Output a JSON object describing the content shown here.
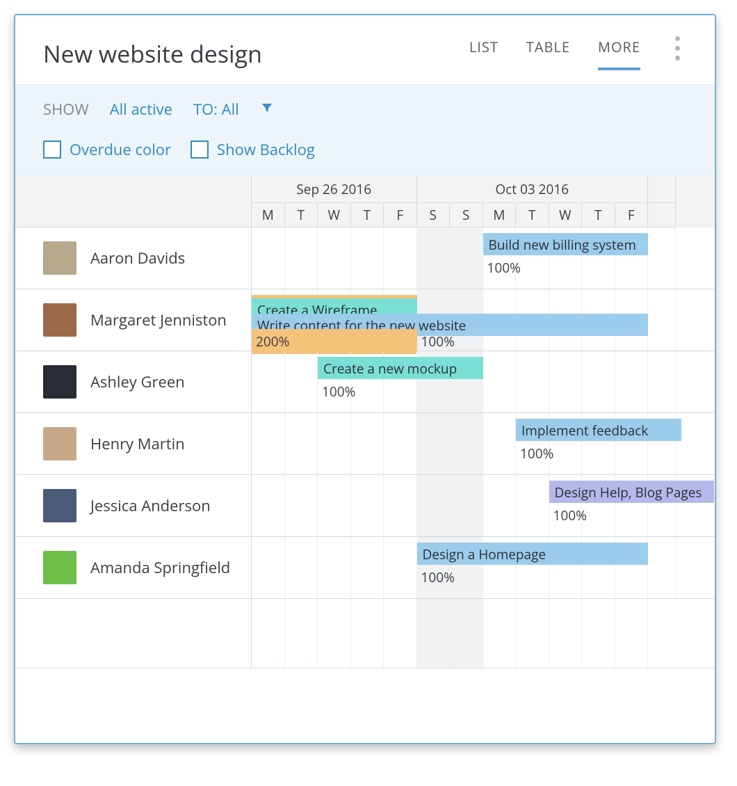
{
  "header": {
    "title": "New website design",
    "tabs": [
      "LIST",
      "TABLE",
      "MORE"
    ],
    "active_tab": 2
  },
  "filters": {
    "show_label": "SHOW",
    "all_active": "All active",
    "to_all": "TO: All",
    "overdue_color": "Overdue color",
    "show_backlog": "Show Backlog"
  },
  "weeks": [
    "Sep 26 2016",
    "Oct 03 2016"
  ],
  "days": [
    "M",
    "T",
    "W",
    "T",
    "F",
    "S",
    "S",
    "M",
    "T",
    "W",
    "T",
    "F"
  ],
  "rows": [
    {
      "name": "Aaron Davids",
      "avatar_bg": "#b8a88c",
      "bars": [
        {
          "label": "Build new billing system",
          "start": 7,
          "span": 5,
          "color": "blue"
        }
      ],
      "pcts": [
        {
          "text": "100%",
          "at": 7
        }
      ]
    },
    {
      "name": "Margaret Jenniston",
      "avatar_bg": "#9a6a4a",
      "bars": [
        {
          "label": "Create a Wireframe",
          "start": 0,
          "span": 5,
          "color": "teal",
          "stripe": "orange"
        },
        {
          "label": "Write content for the new website",
          "start": 0,
          "span": 12,
          "color": "blue"
        }
      ],
      "pcts": [
        {
          "text": "200%",
          "at": 0,
          "bg": "orange",
          "span": 5
        },
        {
          "text": "100%",
          "at": 5
        }
      ]
    },
    {
      "name": "Ashley Green",
      "avatar_bg": "#2b2d36",
      "bars": [
        {
          "label": "Create a new mockup",
          "start": 2,
          "span": 5,
          "color": "teal"
        }
      ],
      "pcts": [
        {
          "text": "100%",
          "at": 2
        }
      ]
    },
    {
      "name": "Henry Martin",
      "avatar_bg": "#c7a98a",
      "bars": [
        {
          "label": "Implement feedback",
          "start": 8,
          "span": 5,
          "color": "blue"
        }
      ],
      "pcts": [
        {
          "text": "100%",
          "at": 8
        }
      ]
    },
    {
      "name": "Jessica Anderson",
      "avatar_bg": "#4a5a78",
      "bars": [
        {
          "label": "Design Help, Blog Pages",
          "start": 9,
          "span": 5,
          "color": "purple"
        }
      ],
      "pcts": [
        {
          "text": "100%",
          "at": 9
        }
      ]
    },
    {
      "name": "Amanda Springfield",
      "avatar_bg": "#6fbf4a",
      "bars": [
        {
          "label": "Design a Homepage",
          "start": 5,
          "span": 7,
          "color": "blue"
        }
      ],
      "pcts": [
        {
          "text": "100%",
          "at": 5
        }
      ]
    }
  ],
  "chart_data": {
    "type": "gantt",
    "title": "New website design",
    "columns_per_day": 1,
    "start_date": "2016-09-26",
    "days": [
      "2016-09-26",
      "2016-09-27",
      "2016-09-28",
      "2016-09-29",
      "2016-09-30",
      "2016-10-01",
      "2016-10-02",
      "2016-10-03",
      "2016-10-04",
      "2016-10-05",
      "2016-10-06",
      "2016-10-07"
    ],
    "weekends": [
      "2016-10-01",
      "2016-10-02"
    ],
    "tasks": [
      {
        "assignee": "Aaron Davids",
        "task": "Build new billing system",
        "start": "2016-10-03",
        "end": "2016-10-07",
        "load": "100%"
      },
      {
        "assignee": "Margaret Jenniston",
        "task": "Create a Wireframe",
        "start": "2016-09-26",
        "end": "2016-09-30",
        "load": "200%"
      },
      {
        "assignee": "Margaret Jenniston",
        "task": "Write content for the new website",
        "start": "2016-09-26",
        "end": "2016-10-07",
        "load": "100%"
      },
      {
        "assignee": "Ashley Green",
        "task": "Create a new mockup",
        "start": "2016-09-28",
        "end": "2016-10-02",
        "load": "100%"
      },
      {
        "assignee": "Henry Martin",
        "task": "Implement feedback",
        "start": "2016-10-04",
        "end": "2016-10-08",
        "load": "100%"
      },
      {
        "assignee": "Jessica Anderson",
        "task": "Design Help, Blog Pages",
        "start": "2016-10-05",
        "end": "2016-10-09",
        "load": "100%"
      },
      {
        "assignee": "Amanda Springfield",
        "task": "Design a Homepage",
        "start": "2016-10-01",
        "end": "2016-10-07",
        "load": "100%"
      }
    ]
  }
}
